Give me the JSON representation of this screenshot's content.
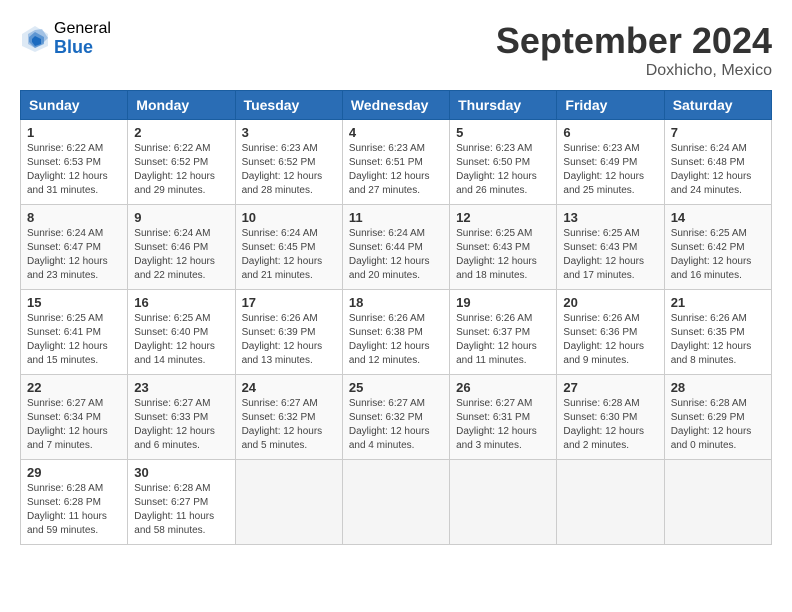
{
  "header": {
    "logo_general": "General",
    "logo_blue": "Blue",
    "month_title": "September 2024",
    "location": "Doxhicho, Mexico"
  },
  "weekdays": [
    "Sunday",
    "Monday",
    "Tuesday",
    "Wednesday",
    "Thursday",
    "Friday",
    "Saturday"
  ],
  "days": [
    {
      "date": "",
      "info": ""
    },
    {
      "date": "",
      "info": ""
    },
    {
      "date": "",
      "info": ""
    },
    {
      "date": "",
      "info": ""
    },
    {
      "date": "",
      "info": ""
    },
    {
      "date": "",
      "info": ""
    },
    {
      "date": "1",
      "sunrise": "Sunrise: 6:22 AM",
      "sunset": "Sunset: 6:53 PM",
      "daylight": "Daylight: 12 hours and 31 minutes."
    },
    {
      "date": "2",
      "sunrise": "Sunrise: 6:22 AM",
      "sunset": "Sunset: 6:52 PM",
      "daylight": "Daylight: 12 hours and 29 minutes."
    },
    {
      "date": "3",
      "sunrise": "Sunrise: 6:23 AM",
      "sunset": "Sunset: 6:52 PM",
      "daylight": "Daylight: 12 hours and 28 minutes."
    },
    {
      "date": "4",
      "sunrise": "Sunrise: 6:23 AM",
      "sunset": "Sunset: 6:51 PM",
      "daylight": "Daylight: 12 hours and 27 minutes."
    },
    {
      "date": "5",
      "sunrise": "Sunrise: 6:23 AM",
      "sunset": "Sunset: 6:50 PM",
      "daylight": "Daylight: 12 hours and 26 minutes."
    },
    {
      "date": "6",
      "sunrise": "Sunrise: 6:23 AM",
      "sunset": "Sunset: 6:49 PM",
      "daylight": "Daylight: 12 hours and 25 minutes."
    },
    {
      "date": "7",
      "sunrise": "Sunrise: 6:24 AM",
      "sunset": "Sunset: 6:48 PM",
      "daylight": "Daylight: 12 hours and 24 minutes."
    },
    {
      "date": "8",
      "sunrise": "Sunrise: 6:24 AM",
      "sunset": "Sunset: 6:47 PM",
      "daylight": "Daylight: 12 hours and 23 minutes."
    },
    {
      "date": "9",
      "sunrise": "Sunrise: 6:24 AM",
      "sunset": "Sunset: 6:46 PM",
      "daylight": "Daylight: 12 hours and 22 minutes."
    },
    {
      "date": "10",
      "sunrise": "Sunrise: 6:24 AM",
      "sunset": "Sunset: 6:45 PM",
      "daylight": "Daylight: 12 hours and 21 minutes."
    },
    {
      "date": "11",
      "sunrise": "Sunrise: 6:24 AM",
      "sunset": "Sunset: 6:44 PM",
      "daylight": "Daylight: 12 hours and 20 minutes."
    },
    {
      "date": "12",
      "sunrise": "Sunrise: 6:25 AM",
      "sunset": "Sunset: 6:43 PM",
      "daylight": "Daylight: 12 hours and 18 minutes."
    },
    {
      "date": "13",
      "sunrise": "Sunrise: 6:25 AM",
      "sunset": "Sunset: 6:43 PM",
      "daylight": "Daylight: 12 hours and 17 minutes."
    },
    {
      "date": "14",
      "sunrise": "Sunrise: 6:25 AM",
      "sunset": "Sunset: 6:42 PM",
      "daylight": "Daylight: 12 hours and 16 minutes."
    },
    {
      "date": "15",
      "sunrise": "Sunrise: 6:25 AM",
      "sunset": "Sunset: 6:41 PM",
      "daylight": "Daylight: 12 hours and 15 minutes."
    },
    {
      "date": "16",
      "sunrise": "Sunrise: 6:25 AM",
      "sunset": "Sunset: 6:40 PM",
      "daylight": "Daylight: 12 hours and 14 minutes."
    },
    {
      "date": "17",
      "sunrise": "Sunrise: 6:26 AM",
      "sunset": "Sunset: 6:39 PM",
      "daylight": "Daylight: 12 hours and 13 minutes."
    },
    {
      "date": "18",
      "sunrise": "Sunrise: 6:26 AM",
      "sunset": "Sunset: 6:38 PM",
      "daylight": "Daylight: 12 hours and 12 minutes."
    },
    {
      "date": "19",
      "sunrise": "Sunrise: 6:26 AM",
      "sunset": "Sunset: 6:37 PM",
      "daylight": "Daylight: 12 hours and 11 minutes."
    },
    {
      "date": "20",
      "sunrise": "Sunrise: 6:26 AM",
      "sunset": "Sunset: 6:36 PM",
      "daylight": "Daylight: 12 hours and 9 minutes."
    },
    {
      "date": "21",
      "sunrise": "Sunrise: 6:26 AM",
      "sunset": "Sunset: 6:35 PM",
      "daylight": "Daylight: 12 hours and 8 minutes."
    },
    {
      "date": "22",
      "sunrise": "Sunrise: 6:27 AM",
      "sunset": "Sunset: 6:34 PM",
      "daylight": "Daylight: 12 hours and 7 minutes."
    },
    {
      "date": "23",
      "sunrise": "Sunrise: 6:27 AM",
      "sunset": "Sunset: 6:33 PM",
      "daylight": "Daylight: 12 hours and 6 minutes."
    },
    {
      "date": "24",
      "sunrise": "Sunrise: 6:27 AM",
      "sunset": "Sunset: 6:32 PM",
      "daylight": "Daylight: 12 hours and 5 minutes."
    },
    {
      "date": "25",
      "sunrise": "Sunrise: 6:27 AM",
      "sunset": "Sunset: 6:32 PM",
      "daylight": "Daylight: 12 hours and 4 minutes."
    },
    {
      "date": "26",
      "sunrise": "Sunrise: 6:27 AM",
      "sunset": "Sunset: 6:31 PM",
      "daylight": "Daylight: 12 hours and 3 minutes."
    },
    {
      "date": "27",
      "sunrise": "Sunrise: 6:28 AM",
      "sunset": "Sunset: 6:30 PM",
      "daylight": "Daylight: 12 hours and 2 minutes."
    },
    {
      "date": "28",
      "sunrise": "Sunrise: 6:28 AM",
      "sunset": "Sunset: 6:29 PM",
      "daylight": "Daylight: 12 hours and 0 minutes."
    },
    {
      "date": "29",
      "sunrise": "Sunrise: 6:28 AM",
      "sunset": "Sunset: 6:28 PM",
      "daylight": "Daylight: 11 hours and 59 minutes."
    },
    {
      "date": "30",
      "sunrise": "Sunrise: 6:28 AM",
      "sunset": "Sunset: 6:27 PM",
      "daylight": "Daylight: 11 hours and 58 minutes."
    },
    {
      "date": "",
      "info": ""
    },
    {
      "date": "",
      "info": ""
    },
    {
      "date": "",
      "info": ""
    },
    {
      "date": "",
      "info": ""
    },
    {
      "date": "",
      "info": ""
    }
  ]
}
